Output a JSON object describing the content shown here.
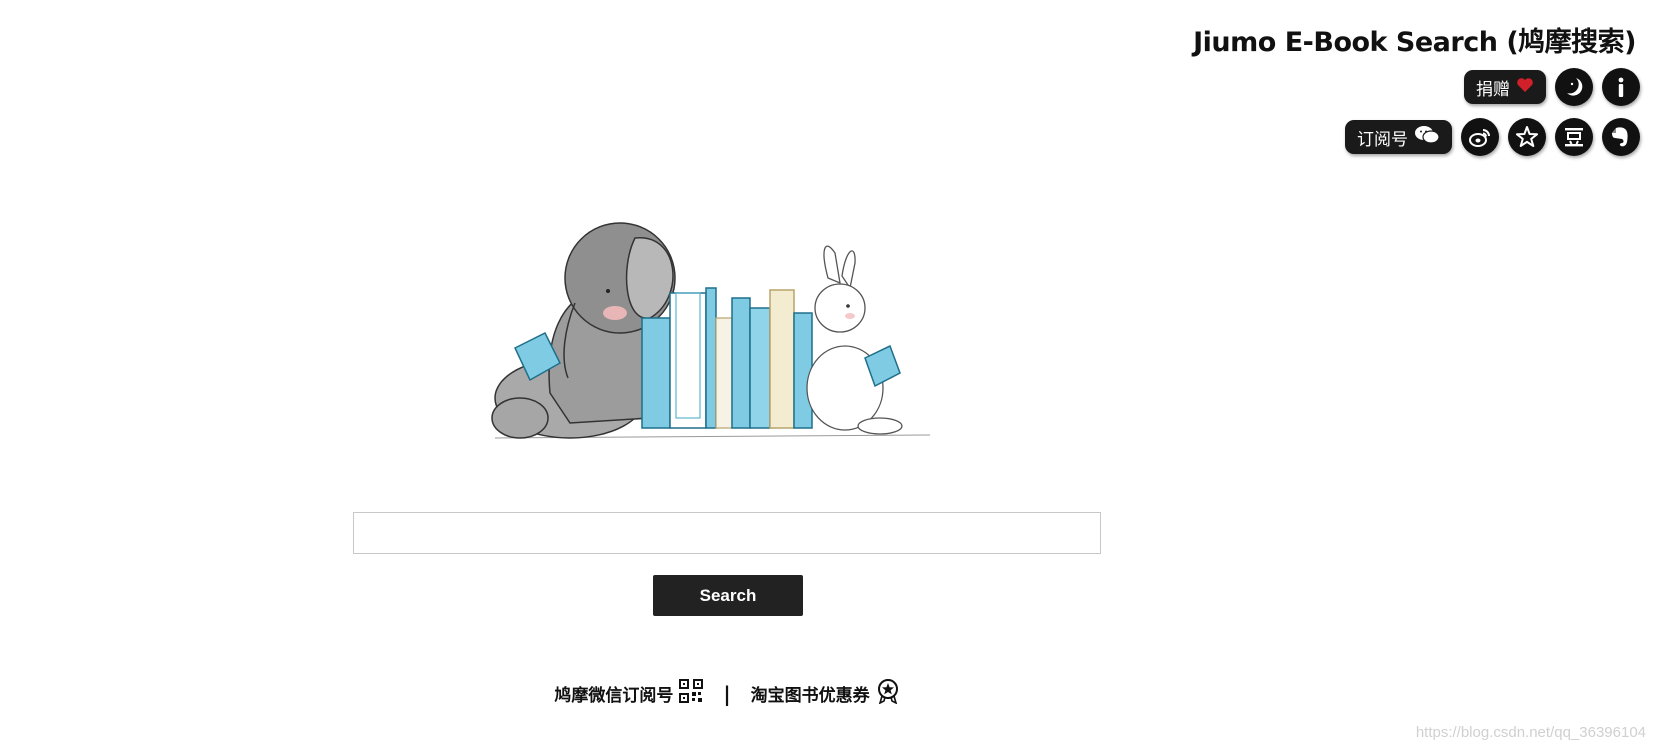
{
  "header": {
    "title": "Jiumo E-Book Search (鸠摩搜索)",
    "donate_label": "捐赠",
    "subscribe_label": "订阅号",
    "icons": [
      "heart-icon",
      "moon-icon",
      "info-icon",
      "wechat-icon",
      "weibo-icon",
      "star-icon",
      "douban-icon",
      "evernote-icon"
    ]
  },
  "hero": {
    "illustration": "elephant-and-rabbit-reading-with-books"
  },
  "search": {
    "value": "",
    "placeholder": "",
    "button_label": "Search"
  },
  "footer": {
    "wechat_link": "鸠摩微信订阅号",
    "separator": "|",
    "taobao_link": "淘宝图书优惠券"
  },
  "watermark": "https://blog.csdn.net/qq_36396104",
  "colors": {
    "dark": "#111111",
    "heart": "#d0202a",
    "book_blue": "#8fd4e8",
    "book_cream": "#f4ecd0"
  }
}
